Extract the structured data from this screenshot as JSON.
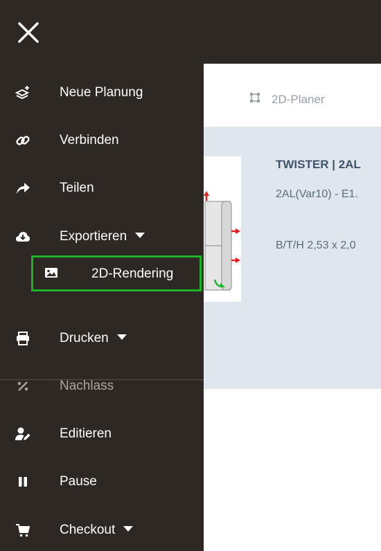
{
  "menu": {
    "items": [
      {
        "label": "Neue Planung",
        "icon": "layers-plus-icon"
      },
      {
        "label": "Verbinden",
        "icon": "link-icon"
      },
      {
        "label": "Teilen",
        "icon": "share-icon"
      },
      {
        "label": "Exportieren",
        "icon": "cloud-download-icon"
      },
      {
        "label": "Drucken",
        "icon": "printer-icon"
      },
      {
        "label": "Nachlass",
        "icon": "percent-icon"
      },
      {
        "label": "Editieren",
        "icon": "user-edit-icon"
      },
      {
        "label": "Pause",
        "icon": "pause-icon"
      },
      {
        "label": "Checkout",
        "icon": "cart-icon"
      }
    ],
    "export_sub": {
      "label": "2D-Rendering",
      "icon": "image-icon"
    }
  },
  "main": {
    "tab_label": "2D-Planer",
    "product": {
      "title": "TWISTER | 2AL",
      "variant": "2AL(Var10) - E1.",
      "dimensions": "B/T/H 2,53 x 2,0"
    }
  },
  "colors": {
    "sidebar_bg": "#2d2824",
    "highlight": "#18b527",
    "panel_bg": "#dfe6ee"
  }
}
